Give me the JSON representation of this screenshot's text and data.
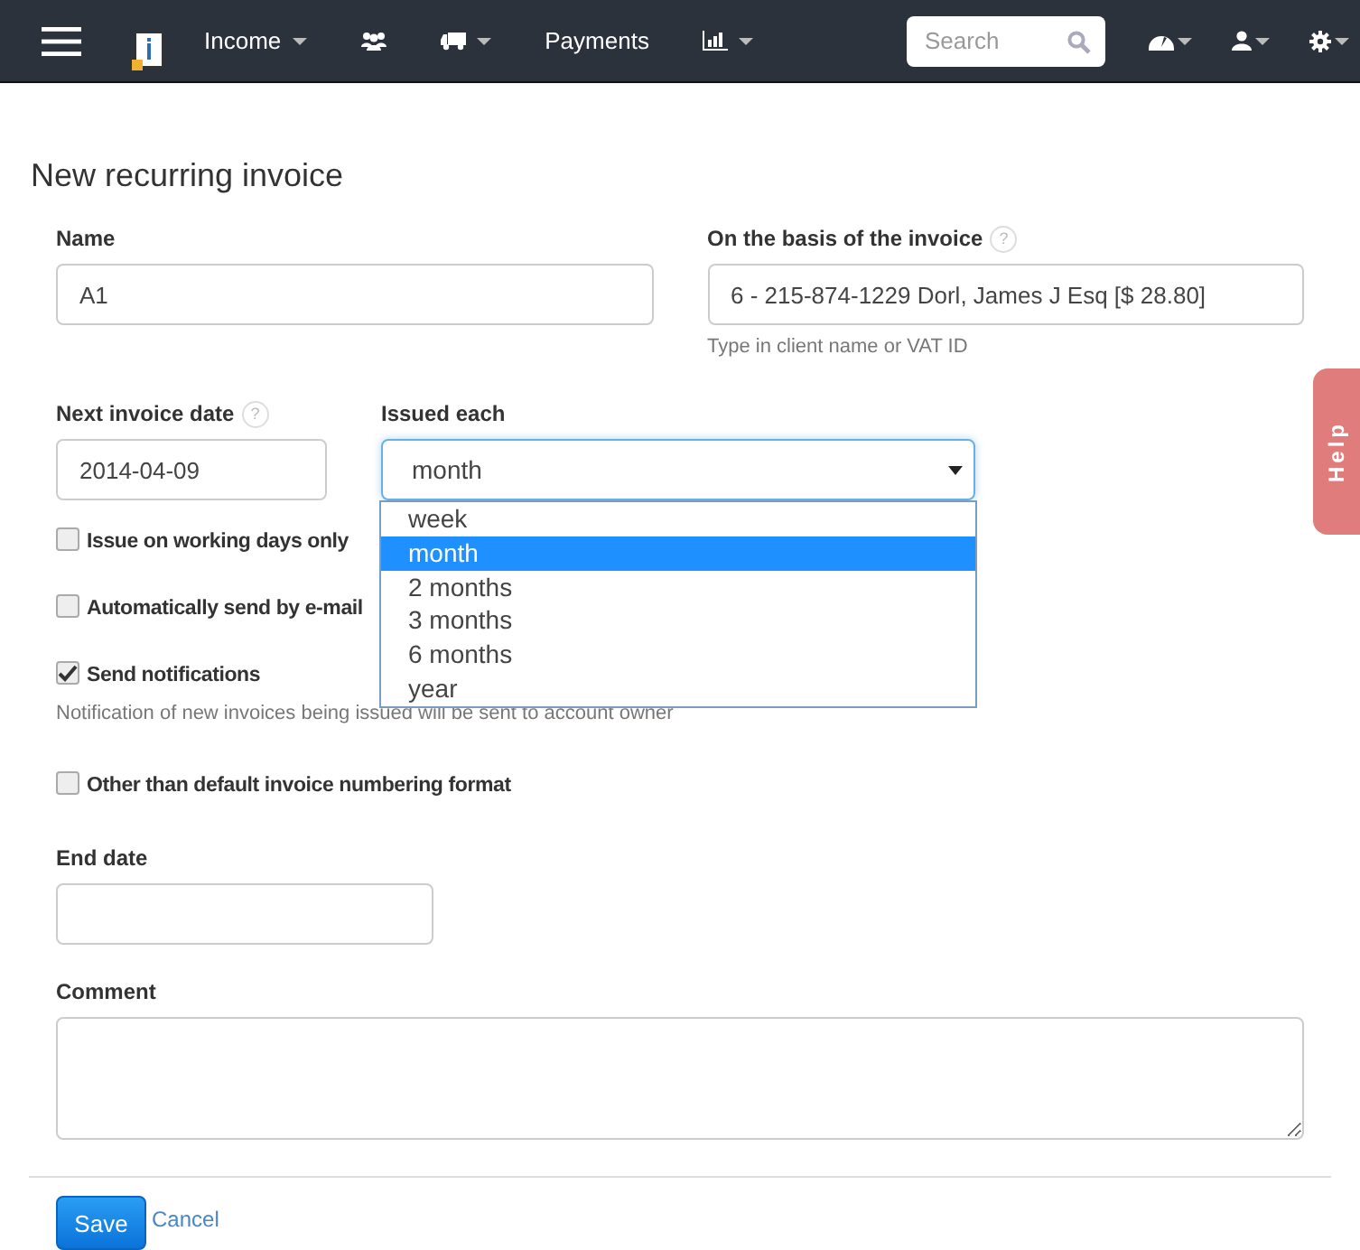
{
  "navbar": {
    "items": [
      {
        "kind": "text",
        "label": "Income",
        "caret": true
      },
      {
        "kind": "icon",
        "caret": false
      },
      {
        "kind": "icon",
        "caret": true
      },
      {
        "kind": "text",
        "label": "Payments",
        "caret": false
      },
      {
        "kind": "icon",
        "caret": true
      }
    ],
    "search": {
      "placeholder": "Search"
    },
    "right": [
      {
        "kind": "icon",
        "caret": true
      },
      {
        "kind": "icon",
        "caret": true
      },
      {
        "kind": "icon",
        "caret": true
      }
    ]
  },
  "title": "New recurring invoice",
  "name": {
    "label": "Name",
    "value": "A1"
  },
  "basis": {
    "label": "On the basis of the invoice",
    "help_mark": "?",
    "value": "6 - 215-874-1229 Dorl, James J Esq [$ 28.80]",
    "hint": "Type in client name or VAT ID"
  },
  "next_date": {
    "label": "Next invoice date",
    "help_mark": "?",
    "value": "2014-04-09"
  },
  "issued_each": {
    "label": "Issued each",
    "value": "month",
    "expanded": true,
    "options": [
      {
        "label": "week",
        "selected": false
      },
      {
        "label": "month",
        "selected": true
      },
      {
        "label": "2 months",
        "selected": false
      },
      {
        "label": "3 months",
        "selected": false
      },
      {
        "label": "6 months",
        "selected": false
      },
      {
        "label": "year",
        "selected": false
      }
    ]
  },
  "checkboxes": [
    {
      "label": "Issue on working days only",
      "checked": false
    },
    {
      "label": "Automatically send by e-mail",
      "checked": false
    },
    {
      "label": "Send notifications",
      "checked": true,
      "hint": "Notification of new invoices being issued will be sent to account owner"
    },
    {
      "label": "Other than default invoice numbering format",
      "checked": false
    }
  ],
  "end_date": {
    "label": "End date"
  },
  "comment": {
    "label": "Comment"
  },
  "buttons": {
    "save": "Save",
    "cancel": "Cancel"
  },
  "help_tab": "Help"
}
